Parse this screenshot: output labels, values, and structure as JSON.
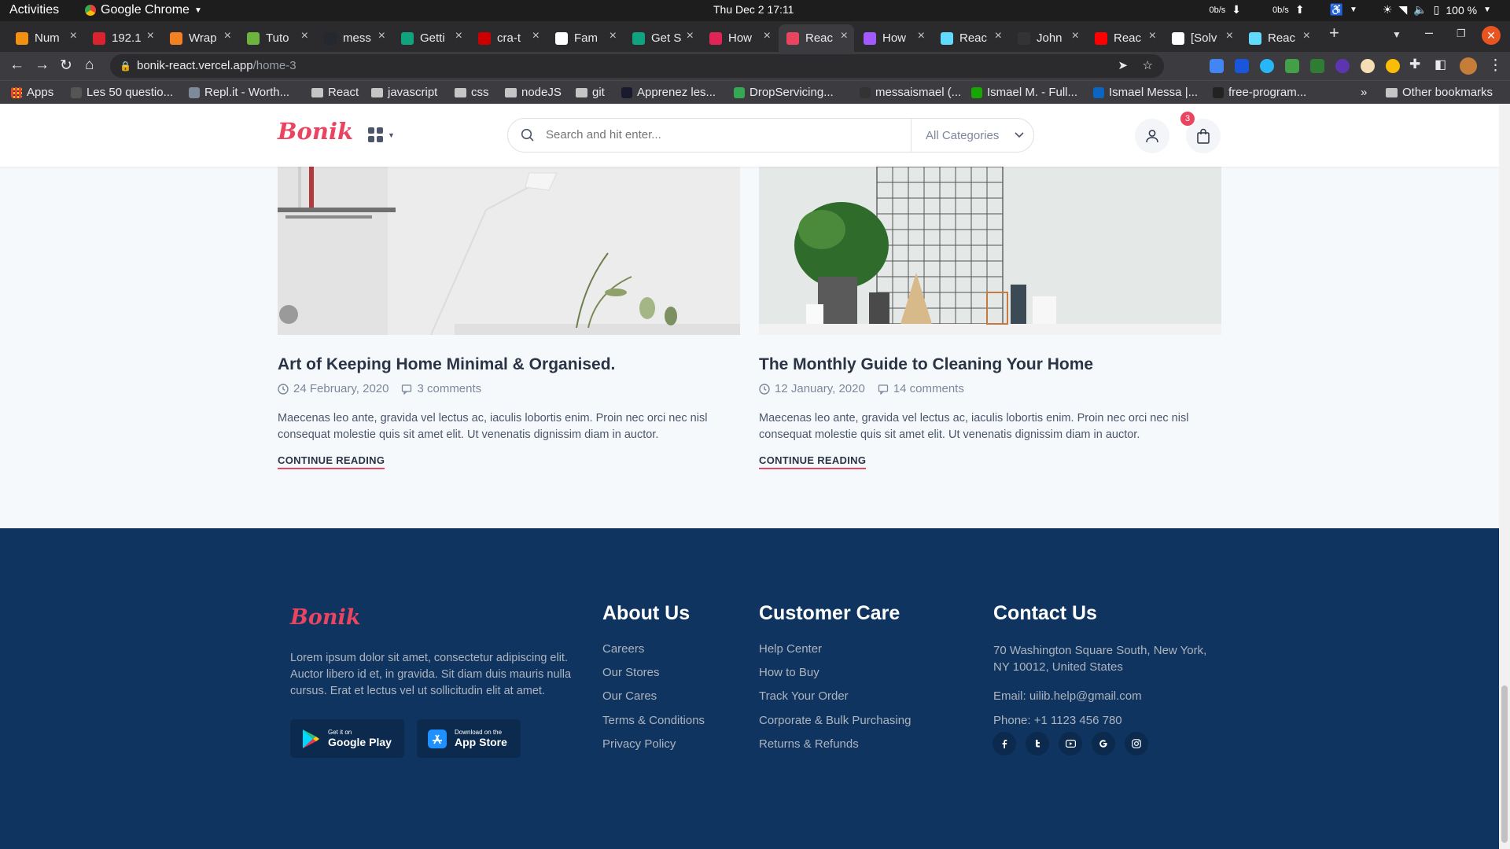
{
  "system_bar": {
    "activities": "Activities",
    "app_name": "Google Chrome",
    "clock": "Thu Dec 2  17:11",
    "net_down": "0b/s",
    "net_up": "0b/s",
    "battery": "100 %"
  },
  "tabs": [
    {
      "title": "Num",
      "color": "#f29111"
    },
    {
      "title": "192.1",
      "color": "#d9232e"
    },
    {
      "title": "Wrap",
      "color": "#f48024"
    },
    {
      "title": "Tuto",
      "color": "#6db33f"
    },
    {
      "title": "mess",
      "color": "#24292f"
    },
    {
      "title": "Getti",
      "color": "#10a37f"
    },
    {
      "title": "cra-t",
      "color": "#cc0000"
    },
    {
      "title": "Fam",
      "color": "#ffffff"
    },
    {
      "title": "Get S",
      "color": "#10a37f"
    },
    {
      "title": "How",
      "color": "#e02454"
    },
    {
      "title": "Reac",
      "color": "#e94560",
      "active": true
    },
    {
      "title": "How",
      "color": "#a259ff"
    },
    {
      "title": "Reac",
      "color": "#61dafb"
    },
    {
      "title": "John",
      "color": "#333333"
    },
    {
      "title": "Reac",
      "color": "#ff0000"
    },
    {
      "title": "[Solv",
      "color": "#ffffff"
    },
    {
      "title": "Reac",
      "color": "#61dafb"
    }
  ],
  "omnibox": {
    "domain": "bonik-react.vercel.app",
    "path": "/home-3"
  },
  "bookmarks": [
    {
      "label": "Apps",
      "type": "apps"
    },
    {
      "label": "Les 50 questio...",
      "type": "site"
    },
    {
      "label": "Repl.it - Worth...",
      "type": "site"
    },
    {
      "label": "React",
      "type": "folder"
    },
    {
      "label": "javascript",
      "type": "folder"
    },
    {
      "label": "css",
      "type": "folder"
    },
    {
      "label": "nodeJS",
      "type": "folder"
    },
    {
      "label": "git",
      "type": "folder"
    },
    {
      "label": "Apprenez les...",
      "type": "site"
    },
    {
      "label": "DropServicing...",
      "type": "site"
    },
    {
      "label": "messaismael (...",
      "type": "site"
    },
    {
      "label": "Ismael M. - Full...",
      "type": "site"
    },
    {
      "label": "Ismael Messa |...",
      "type": "site"
    },
    {
      "label": "free-program...",
      "type": "site"
    }
  ],
  "bookmarks_other": "Other bookmarks",
  "site": {
    "brand": "Bonik",
    "brand_color": "#e94560",
    "search_placeholder": "Search and hit enter...",
    "category": "All Categories",
    "cart_count": "3"
  },
  "posts": [
    {
      "title": "Art of Keeping Home Minimal & Organised.",
      "date": "24 February, 2020",
      "comments": "3 comments",
      "excerpt": "Maecenas leo ante, gravida vel lectus ac, iaculis lobortis enim. Proin nec orci nec nisl consequat molestie quis sit amet elit. Ut venenatis dignissim diam in auctor.",
      "cta": "CONTINUE READING"
    },
    {
      "title": "The Monthly Guide to Cleaning Your Home",
      "date": "12 January, 2020",
      "comments": "14 comments",
      "excerpt": "Maecenas leo ante, gravida vel lectus ac, iaculis lobortis enim. Proin nec orci nec nisl consequat molestie quis sit amet elit. Ut venenatis dignissim diam in auctor.",
      "cta": "CONTINUE READING"
    }
  ],
  "footer": {
    "brand": "Bonik",
    "about_text": "Lorem ipsum dolor sit amet, consectetur adipiscing elit. Auctor libero id et, in gravida. Sit diam duis mauris nulla cursus. Erat et lectus vel ut sollicitudin elit at amet.",
    "google_play": {
      "small": "Get it on",
      "big": "Google Play"
    },
    "app_store": {
      "small": "Download on the",
      "big": "App Store"
    },
    "about": {
      "heading": "About Us",
      "links": [
        "Careers",
        "Our Stores",
        "Our Cares",
        "Terms & Conditions",
        "Privacy Policy"
      ]
    },
    "care": {
      "heading": "Customer Care",
      "links": [
        "Help Center",
        "How to Buy",
        "Track Your Order",
        "Corporate & Bulk Purchasing",
        "Returns & Refunds"
      ]
    },
    "contact": {
      "heading": "Contact Us",
      "address": "70 Washington Square South, New York, NY 10012, United States",
      "email": "Email: uilib.help@gmail.com",
      "phone": "Phone: +1 1123 456 780"
    },
    "social": [
      "facebook-icon",
      "twitter-icon",
      "youtube-icon",
      "google-icon",
      "instagram-icon"
    ],
    "bg_color": "#0f3460"
  }
}
